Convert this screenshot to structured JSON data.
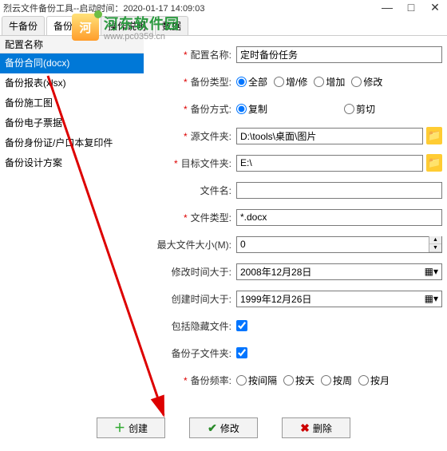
{
  "window": {
    "title": "烈云文件备份工具--启动时间：2020-01-17 14:09:03"
  },
  "watermark": {
    "logo_text": "河",
    "site_name": "河东软件园",
    "site_url": "www.pc0359.cn"
  },
  "tabs": [
    "牛备份",
    "备份配置",
    "操作说明",
    "数据"
  ],
  "sidebar": {
    "header": "配置名称",
    "items": [
      "备份合同(docx)",
      "备份报表(xlsx)",
      "备份施工图",
      "备份电子票据",
      "备份身份证/户口本复印件",
      "备份设计方案"
    ]
  },
  "form": {
    "config_name": {
      "label": "配置名称:",
      "value": "定时备份任务"
    },
    "backup_type": {
      "label": "备份类型:",
      "options": [
        "全部",
        "增/修",
        "增加",
        "修改"
      ],
      "selected": "全部"
    },
    "backup_mode": {
      "label": "备份方式:",
      "options": [
        "复制",
        "剪切"
      ],
      "selected": "复制"
    },
    "src": {
      "label": "源文件夹:",
      "value": "D:\\tools\\桌面\\图片"
    },
    "dst": {
      "label": "目标文件夹:",
      "value": "E:\\"
    },
    "filename": {
      "label": "文件名:",
      "value": ""
    },
    "filetype": {
      "label": "文件类型:",
      "value": "*.docx"
    },
    "maxsize": {
      "label": "最大文件大小(M):",
      "value": "0"
    },
    "mod_after": {
      "label": "修改时间大于:",
      "value": "2008年12月28日"
    },
    "create_after": {
      "label": "创建时间大于:",
      "value": "1999年12月26日"
    },
    "hidden": {
      "label": "包括隐藏文件:"
    },
    "subfolder": {
      "label": "备份子文件夹:"
    },
    "freq": {
      "label": "备份频率:",
      "options": [
        "按间隔",
        "按天",
        "按周",
        "按月"
      ]
    }
  },
  "buttons": {
    "create": "创建",
    "modify": "修改",
    "delete": "删除"
  }
}
